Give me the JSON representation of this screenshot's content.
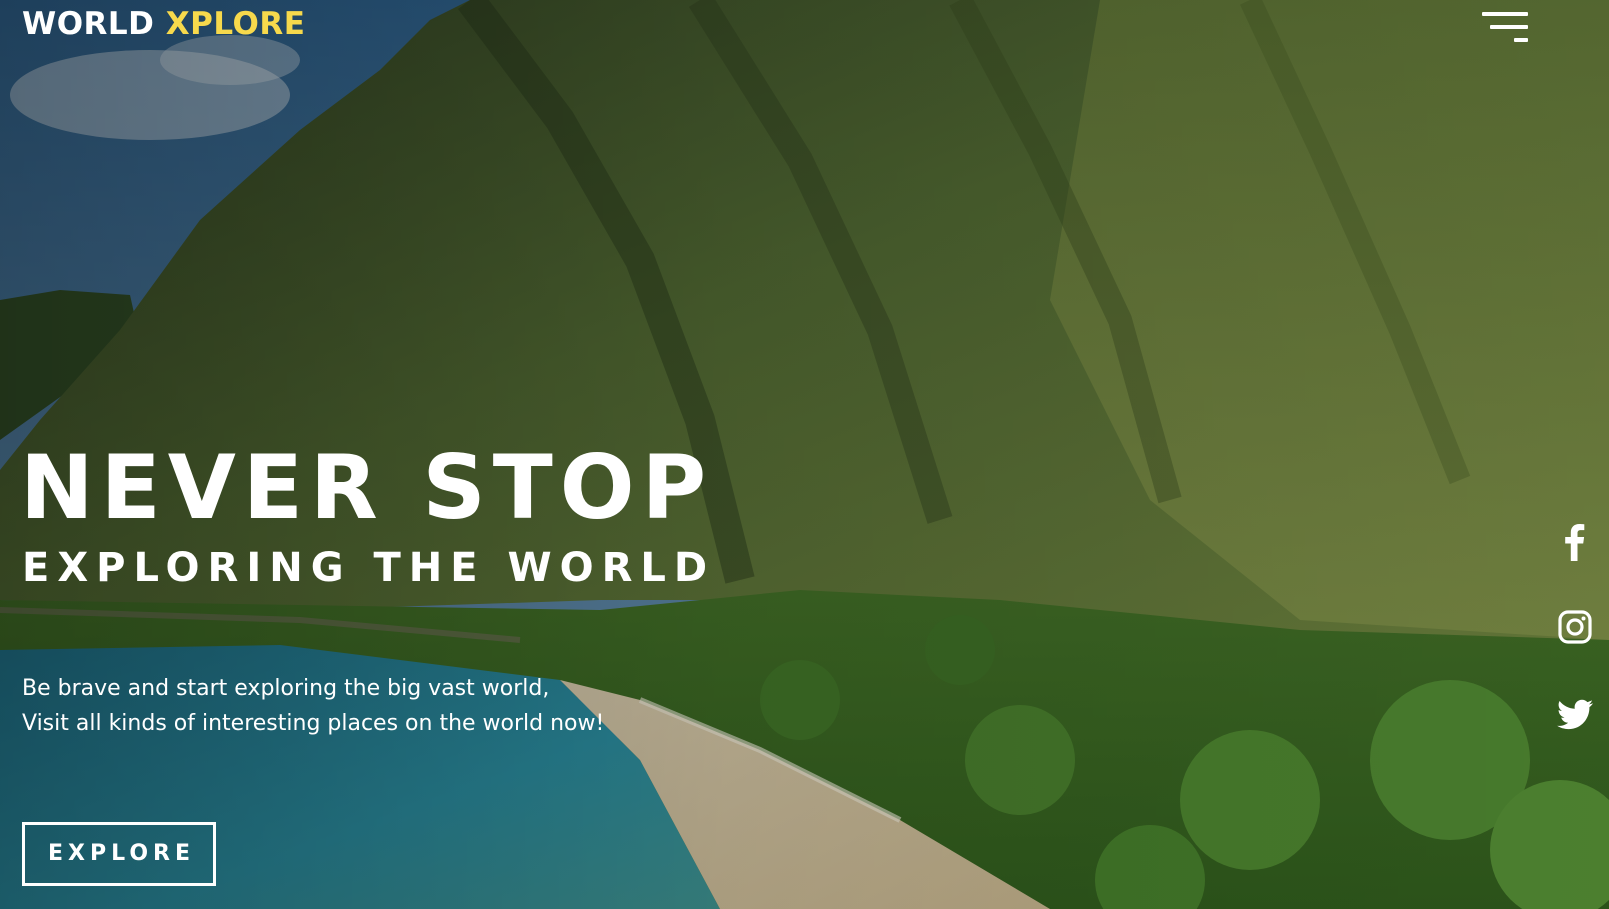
{
  "header": {
    "logo_primary": "WORLD",
    "logo_accent": "XPLORE",
    "accent_color": "#f7d94c",
    "menu_icon": "hamburger-menu-icon"
  },
  "hero": {
    "background": "tropical mountain coastline photo",
    "title": "NEVER STOP",
    "subtitle": "EXPLORING THE WORLD",
    "tagline_lines": [
      "Be brave and start exploring the big vast world,",
      "Visit all kinds of interesting places on the world now!"
    ],
    "cta_label": "EXPLORE"
  },
  "social": [
    {
      "name": "facebook",
      "icon": "facebook-icon"
    },
    {
      "name": "instagram",
      "icon": "instagram-icon"
    },
    {
      "name": "twitter",
      "icon": "twitter-icon"
    }
  ],
  "colors": {
    "text": "#ffffff",
    "accent": "#f7d94c"
  }
}
